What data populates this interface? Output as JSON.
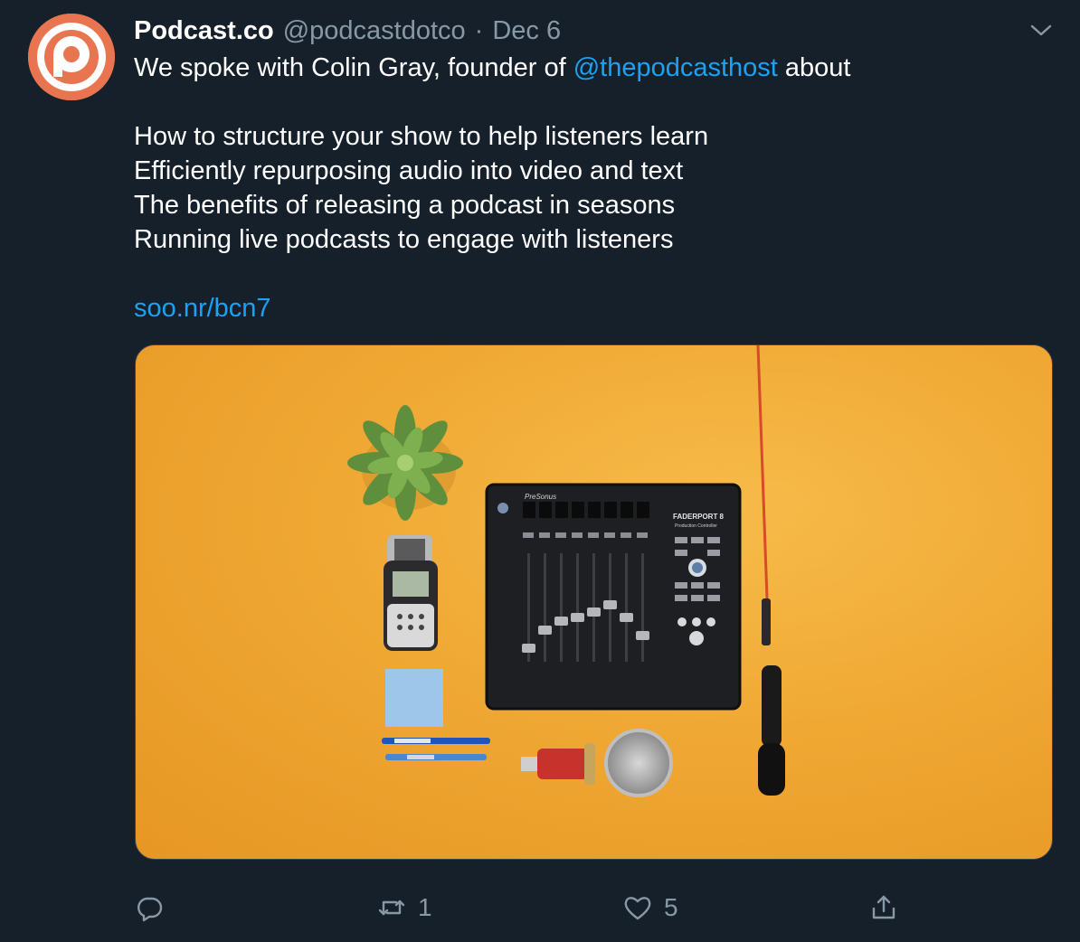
{
  "author": {
    "display_name": "Podcast.co",
    "handle": "@podcastdotco",
    "separator": "·",
    "timestamp": "Dec 6",
    "avatar_icon": "podcastco-logo-icon",
    "avatar_color": "#e8754f"
  },
  "tweet": {
    "intro_prefix": "We spoke with Colin Gray, founder of ",
    "mention": "@thepodcasthost",
    "intro_suffix": " about",
    "topics": [
      "How to structure your show to help listeners learn",
      "Efficiently repurposing audio into video and text",
      "The benefits of releasing a podcast in seasons",
      "Running live podcasts to engage with listeners"
    ],
    "link": "soo.nr/bcn7"
  },
  "media": {
    "device_brand": "PreSonus",
    "device_model": "FADERPORT 8",
    "device_subtitle": "Production Controller",
    "background_color": "#f2a730"
  },
  "actions": {
    "reply_icon": "reply-icon",
    "retweet_icon": "retweet-icon",
    "retweet_count": "1",
    "like_icon": "heart-icon",
    "like_count": "5",
    "share_icon": "share-icon"
  },
  "colors": {
    "background": "#15202b",
    "text": "#ffffff",
    "secondary_text": "#8899a6",
    "link": "#1da1f2"
  }
}
